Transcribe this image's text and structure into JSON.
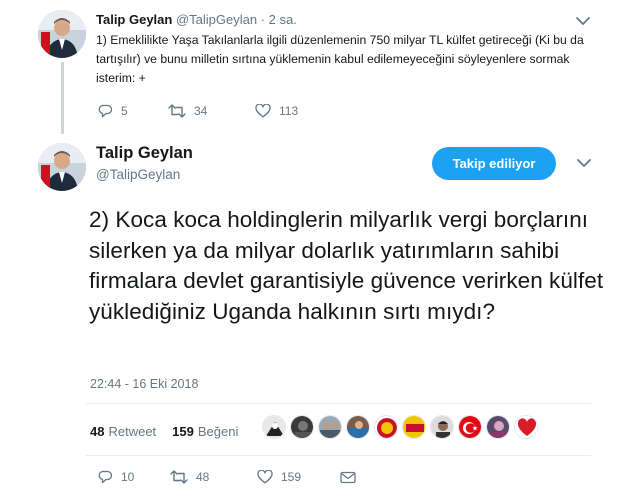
{
  "tweet1": {
    "name": "Talip Geylan",
    "handle": "@TalipGeylan",
    "time": "· 2 sa.",
    "text": "1) Emeklilikte Yaşa Takılanlarla ilgili düzenlemenin 750 milyar TL külfet getireceği (Ki bu da tartışılır) ve bunu milletin sırtına yüklemenin kabul edilemeyeceğini söyleyenlere sormak isterim: +",
    "reply_count": "5",
    "retweet_count": "34",
    "like_count": "113"
  },
  "tweet2": {
    "name": "Talip Geylan",
    "handle": "@TalipGeylan",
    "follow_label": "Takip ediliyor",
    "text": "2) Koca koca holdinglerin milyarlık vergi borçlarını silerken ya da milyar dolarlık yatırımların sahibi firmalara devlet garantisiyle güvence verirken külfet yüklediğiniz Uganda halkının sırtı mıydı?",
    "timestamp": "22:44 - 16 Eki 2018",
    "retweets_num": "48",
    "retweets_label": "Retweet",
    "likes_num": "159",
    "likes_label": "Beğeni",
    "reply_count": "10",
    "retweet_count": "48",
    "like_count": "159"
  },
  "colors": {
    "accent": "#1da1f2",
    "muted": "#657786",
    "text": "#14171a"
  }
}
